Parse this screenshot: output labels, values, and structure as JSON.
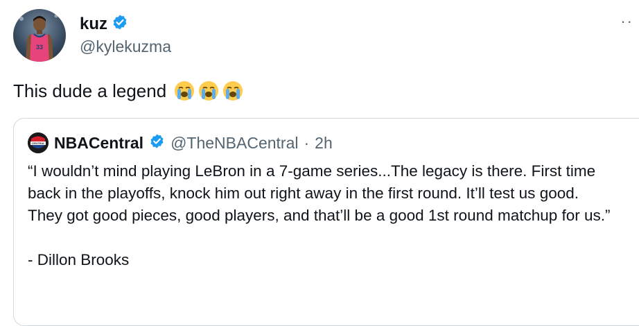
{
  "author": {
    "display_name": "kuz",
    "handle": "@kylekuzma",
    "avatar_jersey_number": "33",
    "verified_color": "#1d9bf0"
  },
  "more_icon": "more-dots-icon",
  "tweet": {
    "text": "This dude a legend",
    "emojis": [
      "loudly-crying-face",
      "loudly-crying-face",
      "loudly-crying-face"
    ]
  },
  "quoted": {
    "display_name": "NBACentral",
    "handle": "@TheNBACentral",
    "separator": "·",
    "time": "2h",
    "logo_text": "CENTRAL",
    "body": "“I wouldn’t mind playing LeBron in a 7-game series...The legacy is there. First time back in the playoffs, knock him out right away in the first round. It’ll test us good. They got good pieces, good players, and that’ll be a good 1st round matchup for us.”\n\n- Dillon Brooks"
  }
}
